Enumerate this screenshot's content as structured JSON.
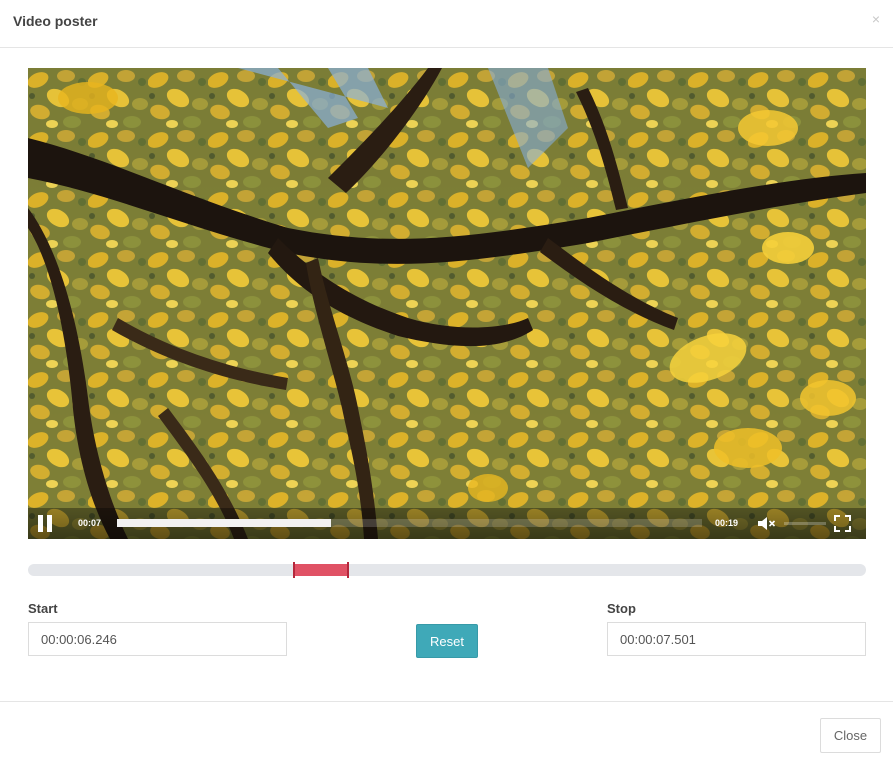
{
  "modal": {
    "title": "Video poster",
    "close_glyph": "×"
  },
  "video": {
    "current_time": "00:07",
    "duration": "00:19",
    "progress_fraction": 0.365,
    "volume_fraction": 0.0,
    "muted": true,
    "icons": [
      "pause-icon",
      "volume-muted-icon",
      "fullscreen-icon"
    ]
  },
  "range": {
    "start_fraction": 0.318,
    "end_fraction": 0.382,
    "selection_color": "#e05265"
  },
  "start": {
    "label": "Start",
    "value": "00:00:06.246"
  },
  "reset": {
    "label": "Reset",
    "color": "#3fa9b8"
  },
  "stop": {
    "label": "Stop",
    "value": "00:00:07.501"
  },
  "footer": {
    "close_label": "Close"
  }
}
